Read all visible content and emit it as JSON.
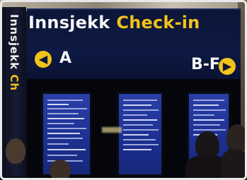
{
  "sign": {
    "title_local": "Innsjekk",
    "title_english": "Check-in",
    "left_gate": "A",
    "right_gate": "B-F",
    "left_arrow_icon": "arrow-left-icon",
    "right_arrow_icon": "arrow-right-icon"
  },
  "side_sign": {
    "text_local": "Innsjekk",
    "text_english": "Ch"
  },
  "colors": {
    "sign_background": "#0e1a44",
    "accent_yellow": "#f2c21b",
    "text_white": "#f5f5f5",
    "monitor_blue": "#1c2f8f"
  }
}
